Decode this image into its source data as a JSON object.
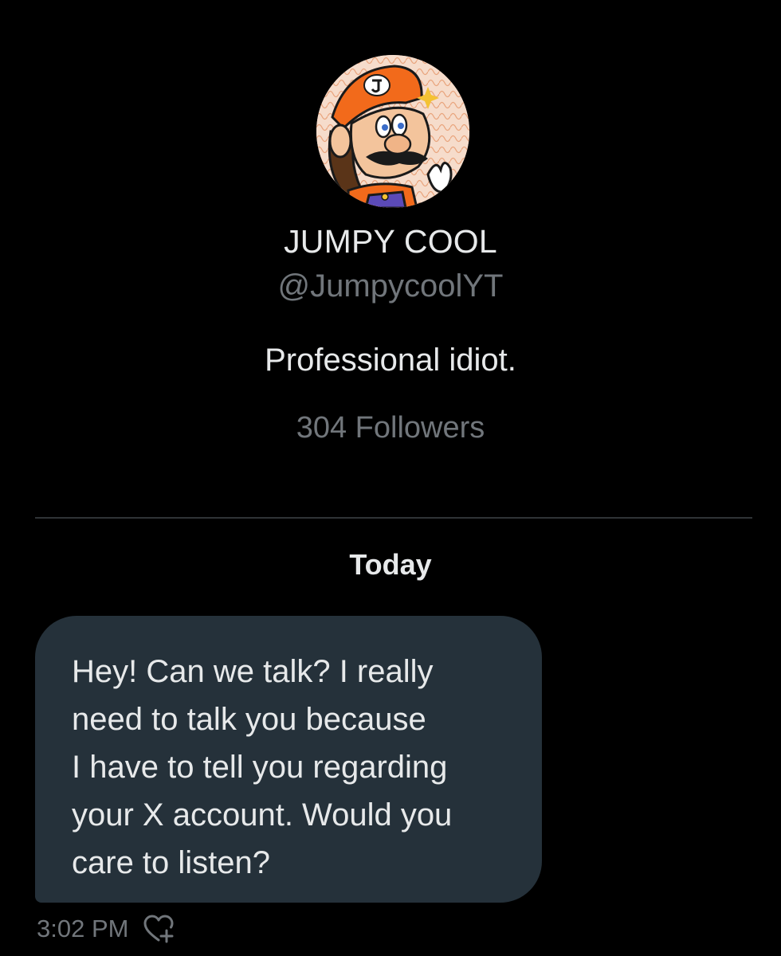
{
  "profile": {
    "display_name": "JUMPY COOL",
    "handle": "@JumpycoolYT",
    "bio": "Professional idiot.",
    "followers_label": "304 Followers"
  },
  "conversation": {
    "day_separator": "Today",
    "messages": [
      {
        "lines": [
          "Hey! Can we talk? I really",
          "need to talk you because",
          "I have to tell you regarding",
          "your X account. Would you",
          "care to listen?"
        ],
        "time": "3:02 PM"
      }
    ]
  },
  "icons": {
    "reaction": "heart-plus-icon"
  },
  "colors": {
    "background": "#000000",
    "primary_text": "#e7e9ea",
    "secondary_text": "#71767b",
    "bubble": "#25313a",
    "divider": "#2f3336"
  }
}
